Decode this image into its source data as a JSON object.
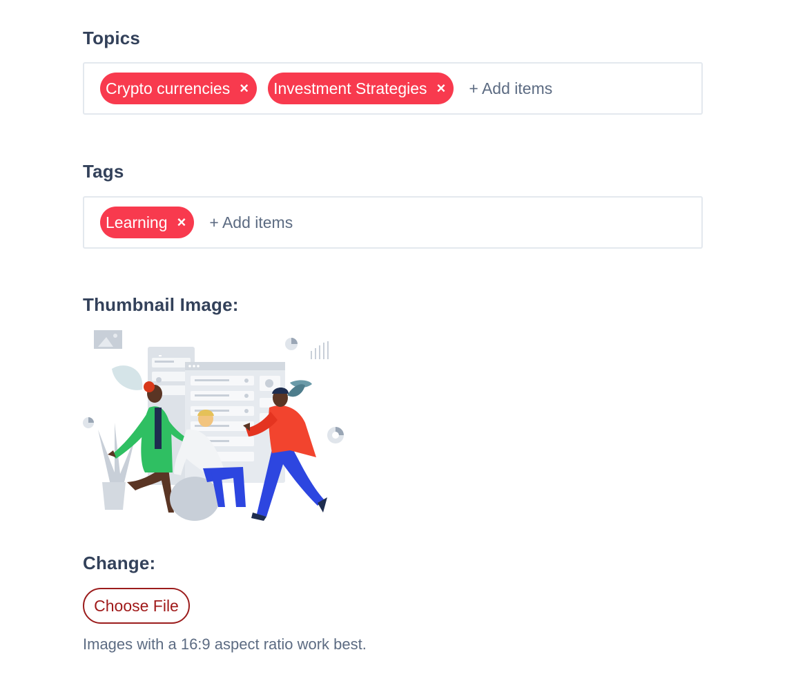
{
  "topics": {
    "label": "Topics",
    "chips": [
      {
        "label": "Crypto currencies",
        "remove": "×"
      },
      {
        "label": "Investment Strategies",
        "remove": "×"
      }
    ],
    "add_placeholder": "+ Add items"
  },
  "tags": {
    "label": "Tags",
    "chips": [
      {
        "label": "Learning",
        "remove": "×"
      }
    ],
    "add_placeholder": "+ Add items"
  },
  "thumbnail": {
    "label": "Thumbnail Image:",
    "illustration": "team-collaboration-illustration"
  },
  "change": {
    "label": "Change:",
    "button_label": "Choose File",
    "hint": "Images with a 16:9 aspect ratio work best."
  },
  "colors": {
    "chip_bg": "#f83a4e",
    "label_text": "#33415a",
    "muted_text": "#5c6b82",
    "button_border": "#9b1c1c"
  }
}
